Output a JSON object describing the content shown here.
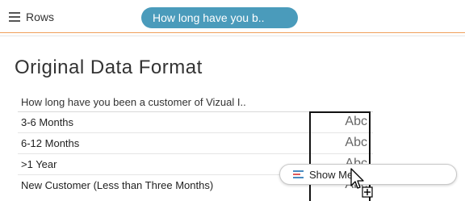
{
  "shelf": {
    "rows_label": "Rows",
    "rows_icon": "rows-list-icon",
    "pill_label": "How long have you b..",
    "pill_color": "#4a9bbb"
  },
  "sheet": {
    "title": "Original Data Format"
  },
  "table": {
    "header": "How long have you been a customer of Vizual I..",
    "rows": [
      {
        "label": "3-6 Months",
        "value": "Abc"
      },
      {
        "label": "6-12 Months",
        "value": "Abc"
      },
      {
        "label": ">1 Year",
        "value": "Abc"
      },
      {
        "label": "New Customer (Less than Three Months)",
        "value": "Abc"
      }
    ]
  },
  "showme": {
    "label": "Show Me",
    "icon": "show-me-chart-icon"
  },
  "cursor": {
    "icon": "drag-copy-cursor-icon"
  }
}
